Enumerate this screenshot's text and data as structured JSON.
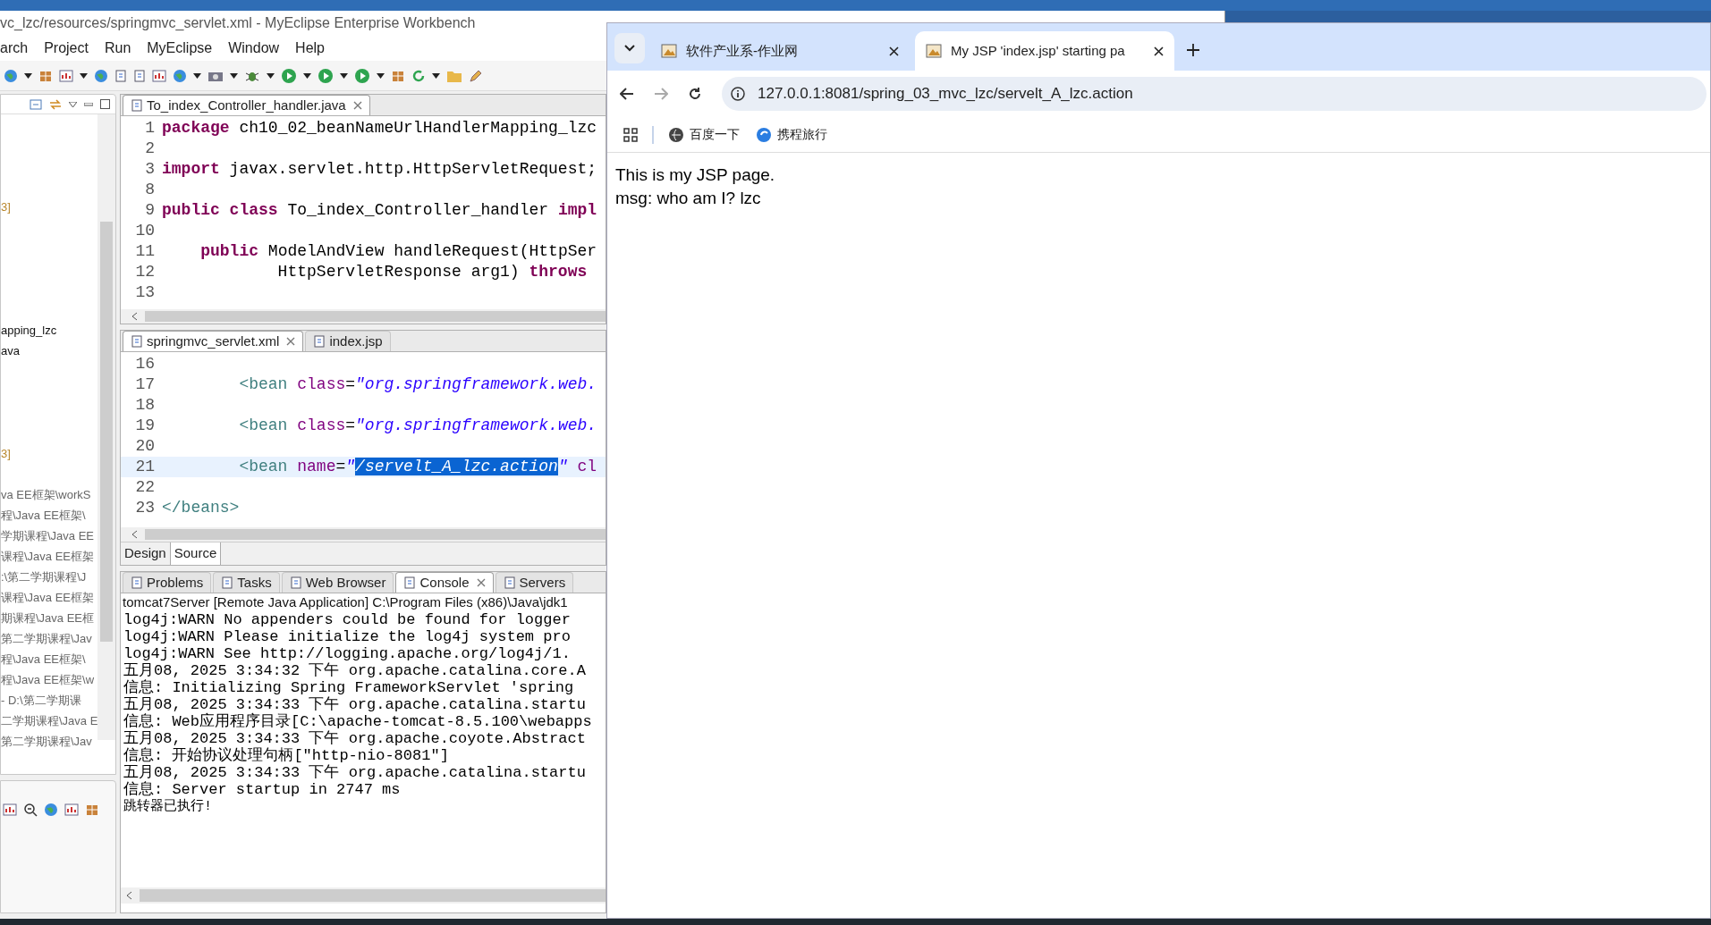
{
  "ide": {
    "title": "vc_lzc/resources/springmvc_servlet.xml - MyEclipse Enterprise Workbench",
    "menu": [
      "arch",
      "Project",
      "Run",
      "MyEclipse",
      "Window",
      "Help"
    ],
    "explorer": [
      {
        "text": "3]",
        "kind": "count"
      },
      {
        "text": "apping_lzc",
        "kind": "name"
      },
      {
        "text": "ava",
        "kind": "name"
      },
      {
        "text": "3]",
        "kind": "count"
      },
      {
        "text": "va EE框架\\workS",
        "kind": "path"
      },
      {
        "text": "程\\Java EE框架\\",
        "kind": "path"
      },
      {
        "text": "学期课程\\Java EE",
        "kind": "path"
      },
      {
        "text": "课程\\Java EE框架",
        "kind": "path"
      },
      {
        "text": ":\\第二学期课程\\J",
        "kind": "path"
      },
      {
        "text": "课程\\Java EE框架",
        "kind": "path"
      },
      {
        "text": "期课程\\Java EE框",
        "kind": "path"
      },
      {
        "text": "第二学期课程\\Jav",
        "kind": "path"
      },
      {
        "text": "程\\Java EE框架\\",
        "kind": "path"
      },
      {
        "text": "程\\Java EE框架\\w",
        "kind": "path"
      },
      {
        "text": "- D:\\第二学期课",
        "kind": "path"
      },
      {
        "text": "二学期课程\\Java E",
        "kind": "path"
      },
      {
        "text": "第二学期课程\\Jav",
        "kind": "path"
      }
    ],
    "java_editor": {
      "tabs": [
        {
          "title": "To_index_Controller_handler.java",
          "selected": true
        }
      ],
      "lines": [
        {
          "number": "1",
          "segments": [
            {
              "kind": "keyword",
              "text": "package"
            },
            {
              "kind": "plain",
              "text": " ch10_02_beanNameUrlHandlerMapping_lzc"
            }
          ]
        },
        {
          "number": "2"
        },
        {
          "number": "3",
          "segments": [
            {
              "kind": "keyword",
              "text": "import"
            },
            {
              "kind": "plain",
              "text": " javax.servlet.http.HttpServletRequest;"
            }
          ]
        },
        {
          "number": "8"
        },
        {
          "number": "9",
          "segments": [
            {
              "kind": "keyword",
              "text": "public class"
            },
            {
              "kind": "plain",
              "text": " To_index_Controller_handler "
            },
            {
              "kind": "keyword",
              "text": "impl"
            }
          ]
        },
        {
          "number": "10"
        },
        {
          "number": "11",
          "segments": [
            {
              "kind": "keyword",
              "text": "    public"
            },
            {
              "kind": "plain",
              "text": " ModelAndView handleRequest(HttpSer"
            }
          ]
        },
        {
          "number": "12",
          "segments": [
            {
              "kind": "plain",
              "text": "            HttpServletResponse arg1) "
            },
            {
              "kind": "keyword",
              "text": "throws"
            }
          ]
        },
        {
          "number": "13"
        }
      ]
    },
    "xml_editor": {
      "tabs": [
        {
          "title": "springmvc_servlet.xml",
          "selected": true
        },
        {
          "title": "index.jsp",
          "selected": false
        }
      ],
      "lines": [
        {
          "number": "16",
          "current": false
        },
        {
          "number": "17",
          "current": false,
          "segments": [
            {
              "kind": "tag",
              "text": "        <bean"
            },
            {
              "kind": "attr",
              "text": " class"
            },
            {
              "kind": "plain",
              "text": "="
            },
            {
              "kind": "string",
              "text": "\"org.springframework.web."
            }
          ]
        },
        {
          "number": "18",
          "current": false
        },
        {
          "number": "19",
          "current": false,
          "segments": [
            {
              "kind": "tag",
              "text": "        <bean"
            },
            {
              "kind": "attr",
              "text": " class"
            },
            {
              "kind": "plain",
              "text": "="
            },
            {
              "kind": "string",
              "text": "\"org.springframework.web."
            }
          ]
        },
        {
          "number": "20",
          "current": false
        },
        {
          "number": "21",
          "current": true,
          "segments": [
            {
              "kind": "tag",
              "text": "        <bean"
            },
            {
              "kind": "attr",
              "text": " name"
            },
            {
              "kind": "plain",
              "text": "="
            },
            {
              "kind": "string",
              "text": "\""
            },
            {
              "kind": "selection",
              "text": "/servelt_A_lzc.action"
            },
            {
              "kind": "string",
              "text": "\""
            },
            {
              "kind": "attr",
              "text": " cl"
            }
          ]
        },
        {
          "number": "22",
          "current": false
        },
        {
          "number": "23",
          "current": false,
          "segments": [
            {
              "kind": "tag",
              "text": "</beans>"
            }
          ]
        }
      ],
      "modes": [
        {
          "label": "Design",
          "selected": false
        },
        {
          "label": "Source",
          "selected": true
        }
      ]
    },
    "console": {
      "tabs": [
        {
          "title": "Problems",
          "selected": false
        },
        {
          "title": "Tasks",
          "selected": false
        },
        {
          "title": "Web Browser",
          "selected": false
        },
        {
          "title": "Console",
          "selected": true
        },
        {
          "title": "Servers",
          "selected": false
        }
      ],
      "header": "tomcat7Server [Remote Java Application] C:\\Program Files (x86)\\Java\\jdk1",
      "lines": [
        "log4j:WARN No appenders could be found for logger",
        "log4j:WARN Please initialize the log4j system pro",
        "log4j:WARN See http://logging.apache.org/log4j/1.",
        "五月08, 2025 3:34:32 下午 org.apache.catalina.core.A",
        "信息: Initializing Spring FrameworkServlet 'spring",
        "五月08, 2025 3:34:33 下午 org.apache.catalina.startu",
        "信息: Web应用程序目录[C:\\apache-tomcat-8.5.100\\webapps",
        "五月08, 2025 3:34:33 下午 org.apache.coyote.Abstract",
        "信息: 开始协议处理句柄[\"http-nio-8081\"]",
        "五月08, 2025 3:34:33 下午 org.apache.catalina.startu",
        "信息: Server startup in 2747 ms",
        "跳转器已执行!"
      ]
    }
  },
  "browser": {
    "tabs": [
      {
        "title": "软件产业系-作业网",
        "selected": false
      },
      {
        "title": "My JSP 'index.jsp' starting pa",
        "selected": true
      }
    ],
    "url": "127.0.0.1:8081/spring_03_mvc_lzc/servelt_A_lzc.action",
    "bookmarks": [
      "百度一下",
      "携程旅行"
    ],
    "page_lines": [
      "This is my JSP page.",
      "msg: who am I? lzc"
    ]
  }
}
